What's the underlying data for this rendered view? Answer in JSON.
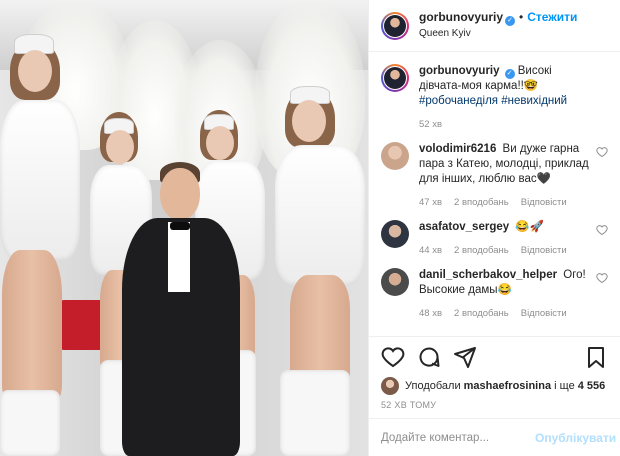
{
  "post": {
    "author": "gorbunovyuriy",
    "follow_label": "Стежити",
    "dot": "•",
    "location": "Queen Kyiv",
    "caption": {
      "username": "gorbunovyuriy",
      "text": "Високі дівчата-моя карма!!",
      "emoji": "🤓",
      "tag1": "#робочанеділя",
      "tag2": "#невихідний",
      "time": "52 хв"
    },
    "comments": [
      {
        "username": "volodimir6216",
        "text": "Ви дуже гарна пара з Катею, молодці, приклад для інших, люблю вас🖤",
        "time": "47 хв",
        "likes": "2 вподобань",
        "reply": "Відповісти"
      },
      {
        "username": "asafatov_sergey",
        "text": "😂🚀",
        "time": "44 хв",
        "likes": "2 вподобань",
        "reply": "Відповісти"
      },
      {
        "username": "danil_scherbakov_helper",
        "text": "Ого! Высокие дамы😂",
        "time": "48 хв",
        "likes": "2 вподобань",
        "reply": "Відповісти"
      }
    ],
    "likes_text_prefix": "Уподобали",
    "likes_user": "mashaefrosinina",
    "likes_text_mid": "і ще",
    "likes_count": "4 556",
    "time_ago": "52 хв тому",
    "comment_placeholder": "Додайте коментар...",
    "publish_label": "Опублікувати"
  },
  "icons": [
    "verified-icon",
    "heart-icon",
    "comment-icon",
    "share-icon",
    "bookmark-icon"
  ],
  "colors": {
    "accent": "#0095f6",
    "publish_disabled": "#b2dffc",
    "muted": "#8e8e8e",
    "verified": "#3897f0"
  }
}
